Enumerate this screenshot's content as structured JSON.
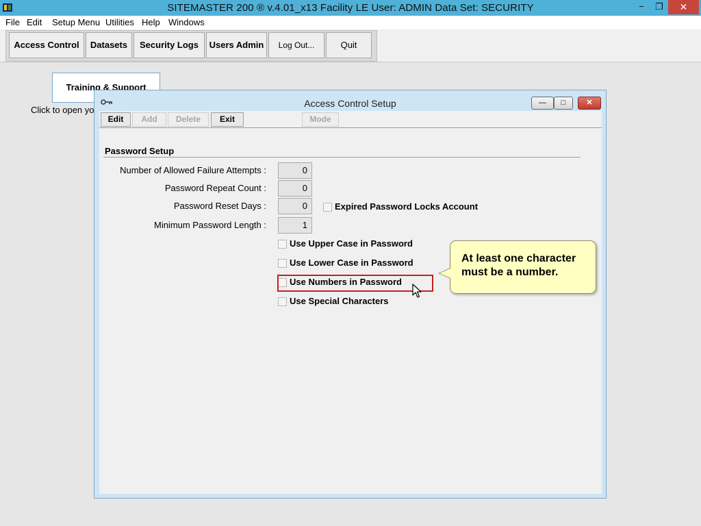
{
  "app": {
    "title": "SITEMASTER 200 ® v.4.01_x13 Facility LE    User: ADMIN    Data Set: SECURITY",
    "window_controls": {
      "minimize": "−",
      "restore": "❐",
      "close": "✕"
    }
  },
  "menu": {
    "items": [
      "File",
      "Edit",
      "Setup Menu",
      "Utilities",
      "Help",
      "Windows"
    ]
  },
  "toolbar": {
    "buttons": [
      "Access Control",
      "Datasets",
      "Security Logs",
      "Users Admin",
      "Log Out...",
      "Quit"
    ]
  },
  "background": {
    "training_label": "Training & Support",
    "hint_text": "Click to open yo"
  },
  "dialog": {
    "title": "Access Control Setup",
    "controls": {
      "minimize": "—",
      "maximize": "□",
      "close": "✕"
    },
    "toolbar": {
      "edit": "Edit",
      "add": "Add",
      "delete": "Delete",
      "exit": "Exit",
      "mode": "Mode"
    },
    "section_title": "Password Setup",
    "fields": [
      {
        "label": "Number of Allowed Failure Attempts :",
        "value": "0"
      },
      {
        "label": "Password Repeat Count :",
        "value": "0"
      },
      {
        "label": "Password Reset Days :",
        "value": "0"
      },
      {
        "label": "Minimum Password Length :",
        "value": "1"
      }
    ],
    "checkboxes": {
      "expired_locks": {
        "label": "Expired Password Locks Account",
        "checked": false
      },
      "upper_case": {
        "label": "Use Upper Case in Password",
        "checked": false
      },
      "lower_case": {
        "label": "Use Lower Case in Password",
        "checked": false
      },
      "numbers": {
        "label": "Use Numbers in Password",
        "checked": false
      },
      "special": {
        "label": "Use Special Characters",
        "checked": false
      }
    }
  },
  "callout": {
    "text": "At least one character must be a number."
  },
  "colors": {
    "titlebar": "#4fb1d8",
    "close_button": "#c7463b",
    "highlight": "#c81e1e",
    "callout_bg": "#ffffc2",
    "dialog_frame": "#cde5f5"
  }
}
